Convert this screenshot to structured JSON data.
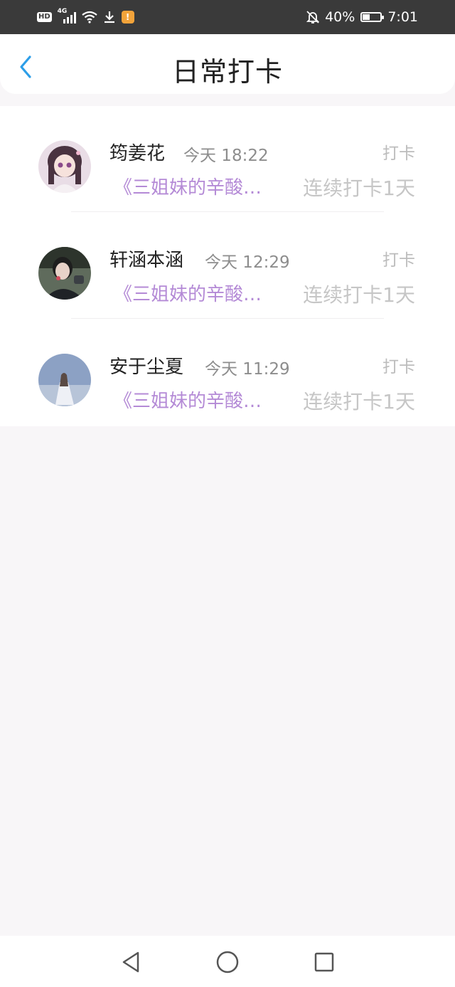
{
  "status_bar": {
    "network_type": "4G",
    "hd_label": "HD",
    "battery": "40%",
    "battery_level": 0.4,
    "time": "7:01",
    "icons": [
      "hd-icon",
      "signal-icon",
      "wifi-icon",
      "download-icon",
      "app-notification-icon",
      "bell-off-icon",
      "battery-icon"
    ]
  },
  "header": {
    "title": "日常打卡",
    "back_icon": "chevron-left-icon",
    "accent_color": "#2d9ee8"
  },
  "checkins": [
    {
      "name": "筠姜花",
      "time": "今天 18:22",
      "action": "打卡",
      "book": "《三姐妹的辛酸史》",
      "streak": "连续打卡1天"
    },
    {
      "name": "轩涵本涵",
      "time": "今天 12:29",
      "action": "打卡",
      "book": "《三姐妹的辛酸史》",
      "streak": "连续打卡1天"
    },
    {
      "name": "安于尘夏",
      "time": "今天 11:29",
      "action": "打卡",
      "book": "《三姐妹的辛酸史》",
      "streak": "连续打卡1天"
    }
  ],
  "nav_bar": {
    "icons": [
      "back-triangle-icon",
      "home-circle-icon",
      "recents-square-icon"
    ]
  }
}
